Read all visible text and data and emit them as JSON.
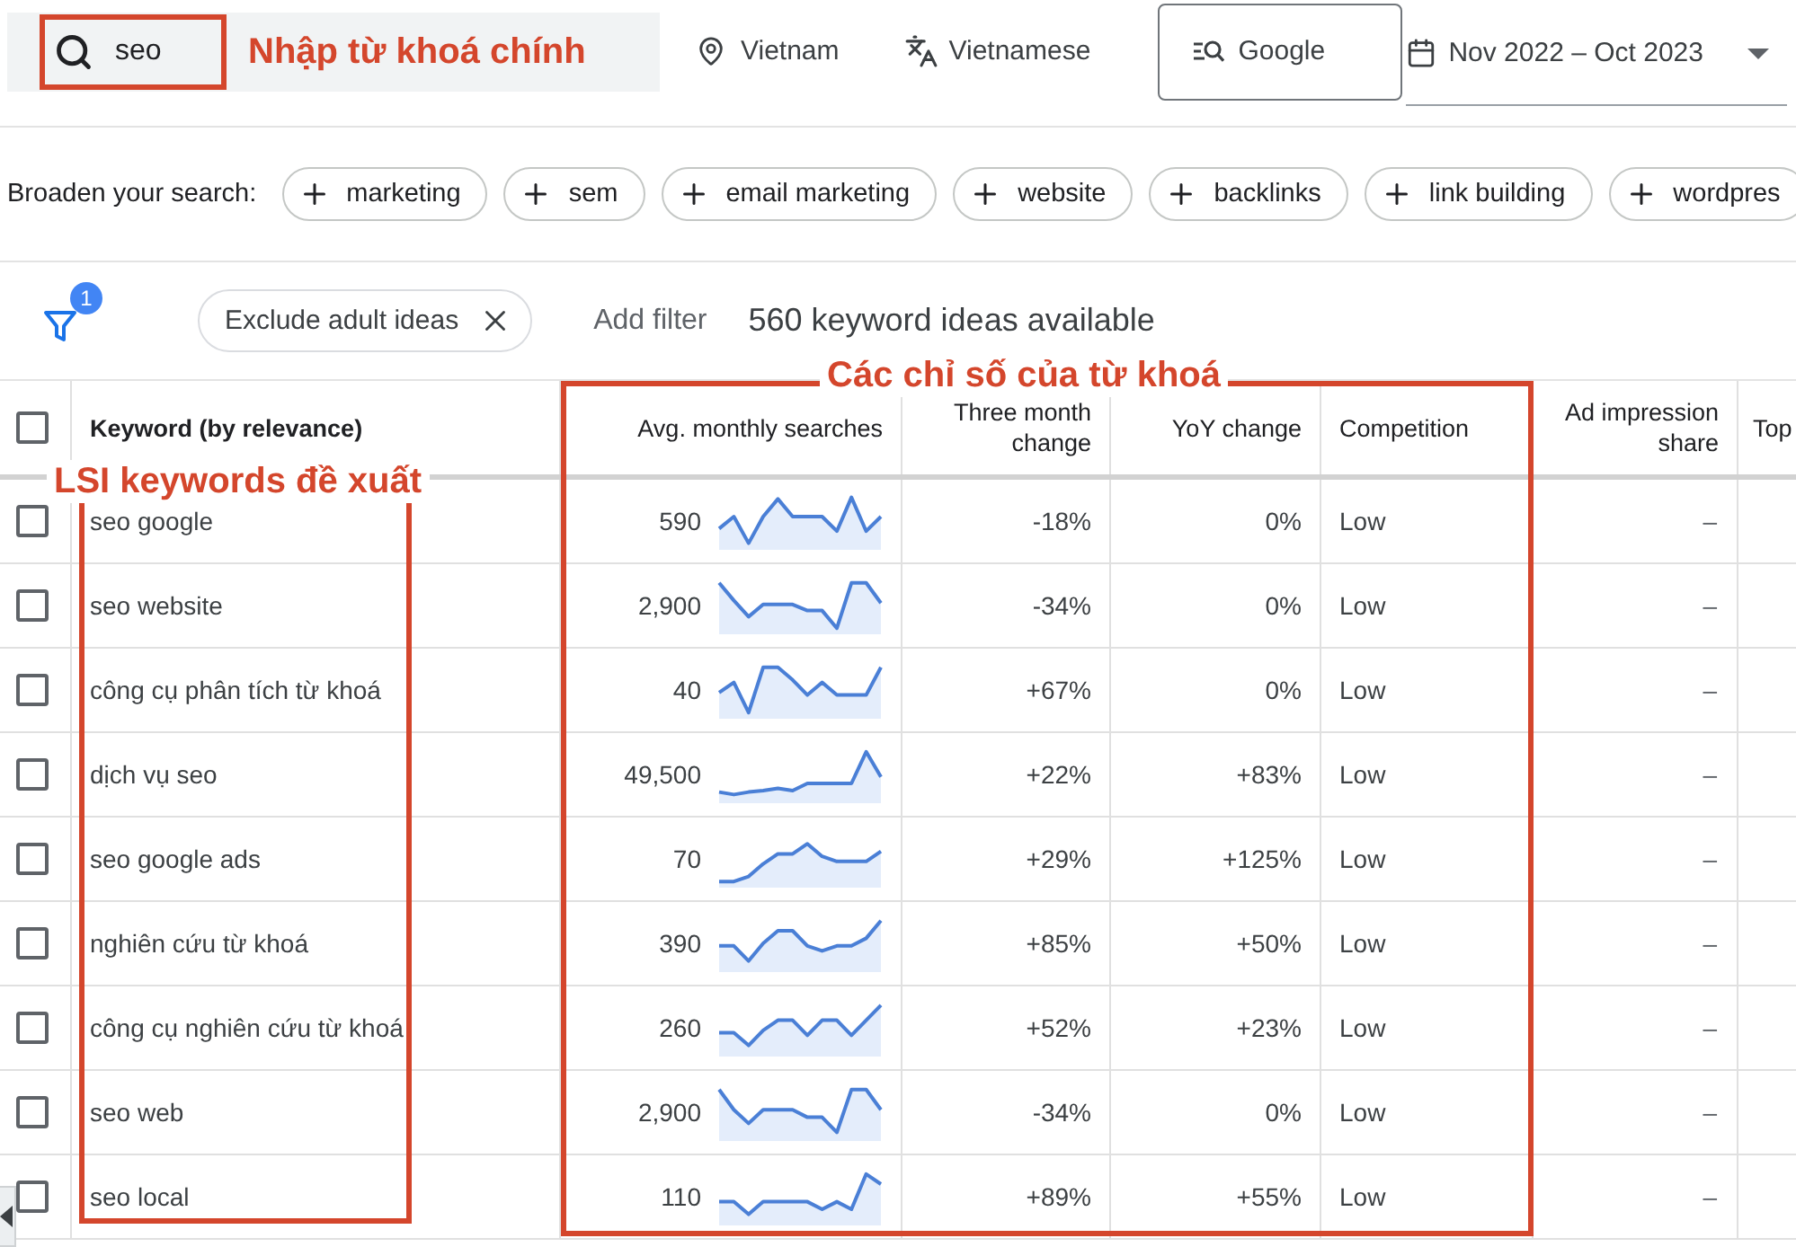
{
  "search_bar": {
    "value": "seo",
    "annotation": "Nhập từ khoá chính"
  },
  "location": "Vietnam",
  "language": "Vietnamese",
  "network": "Google",
  "date_range": "Nov 2022 – Oct 2023",
  "broaden": {
    "label": "Broaden your search:",
    "chips": [
      "marketing",
      "sem",
      "email marketing",
      "website",
      "backlinks",
      "link building",
      "wordpres"
    ]
  },
  "filters": {
    "count": "1",
    "chips": [
      "Exclude adult ideas"
    ],
    "add_filter": "Add filter",
    "summary": "560 keyword ideas available"
  },
  "table": {
    "select_all_checked": false,
    "columns": [
      "Keyword (by relevance)",
      "Avg. monthly searches",
      "Three month change",
      "YoY change",
      "Competition",
      "Ad impression share",
      "Top"
    ],
    "metrics_annotation": "Các chỉ số của từ khoá",
    "keywords_annotation": "LSI keywords đề xuất",
    "rows": [
      {
        "checked": false,
        "keyword": "seo google",
        "avg_monthly_searches": "590",
        "three_month_change": "-18%",
        "yoy_change": "0%",
        "competition": "Low",
        "ad_impression_share": "–"
      },
      {
        "checked": false,
        "keyword": "seo website",
        "avg_monthly_searches": "2,900",
        "three_month_change": "-34%",
        "yoy_change": "0%",
        "competition": "Low",
        "ad_impression_share": "–"
      },
      {
        "checked": false,
        "keyword": "công cụ phân tích từ khoá",
        "avg_monthly_searches": "40",
        "three_month_change": "+67%",
        "yoy_change": "0%",
        "competition": "Low",
        "ad_impression_share": "–"
      },
      {
        "checked": false,
        "keyword": "dịch vụ seo",
        "avg_monthly_searches": "49,500",
        "three_month_change": "+22%",
        "yoy_change": "+83%",
        "competition": "Low",
        "ad_impression_share": "–"
      },
      {
        "checked": false,
        "keyword": "seo google ads",
        "avg_monthly_searches": "70",
        "three_month_change": "+29%",
        "yoy_change": "+125%",
        "competition": "Low",
        "ad_impression_share": "–"
      },
      {
        "checked": false,
        "keyword": "nghiên cứu từ khoá",
        "avg_monthly_searches": "390",
        "three_month_change": "+85%",
        "yoy_change": "+50%",
        "competition": "Low",
        "ad_impression_share": "–"
      },
      {
        "checked": false,
        "keyword": "công cụ nghiên cứu từ khoá",
        "avg_monthly_searches": "260",
        "three_month_change": "+52%",
        "yoy_change": "+23%",
        "competition": "Low",
        "ad_impression_share": "–"
      },
      {
        "checked": false,
        "keyword": "seo web",
        "avg_monthly_searches": "2,900",
        "three_month_change": "-34%",
        "yoy_change": "0%",
        "competition": "Low",
        "ad_impression_share": "–"
      },
      {
        "checked": false,
        "keyword": "seo local",
        "avg_monthly_searches": "110",
        "three_month_change": "+89%",
        "yoy_change": "+55%",
        "competition": "Low",
        "ad_impression_share": "–"
      }
    ]
  }
}
